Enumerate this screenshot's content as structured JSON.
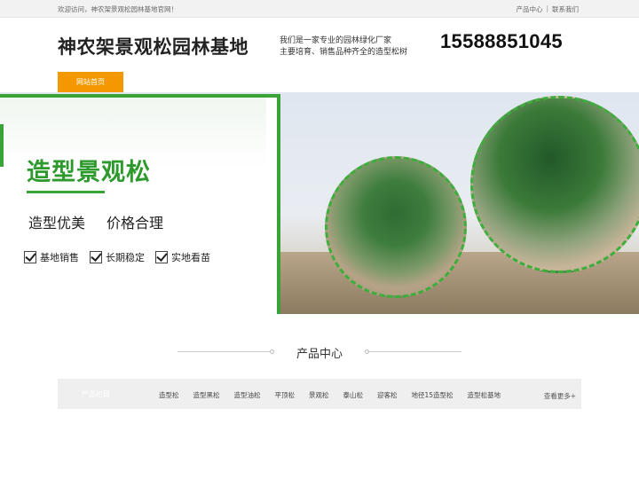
{
  "topbar": {
    "welcome": "欢迎访问，神农架景观松园林基地官网！",
    "links": [
      "产品中心",
      "联系我们"
    ],
    "separator": "|"
  },
  "header": {
    "site_title": "神农架景观松园林基地",
    "tagline_line1": "我们是一家专业的园林绿化厂家",
    "tagline_line2": "主要培育、销售品种齐全的造型松树",
    "phone": "15588851045",
    "nav_home": "网站首页"
  },
  "banner": {
    "headline": "造型景观松",
    "features": [
      "造型优美",
      "价格合理"
    ],
    "checks": [
      "基地销售",
      "长期稳定",
      "实地看苗"
    ]
  },
  "products": {
    "section_title": "产品中心",
    "category_heading": "产品栏目",
    "categories": [
      "造型松",
      "造型黑松",
      "造型油松",
      "平顶松",
      "景观松",
      "泰山松",
      "迎客松",
      "地径15造型松",
      "造型松基地"
    ],
    "more_label": "查看更多+"
  },
  "colors": {
    "accent_orange": "#f39800",
    "brand_green": "#3aa338"
  }
}
